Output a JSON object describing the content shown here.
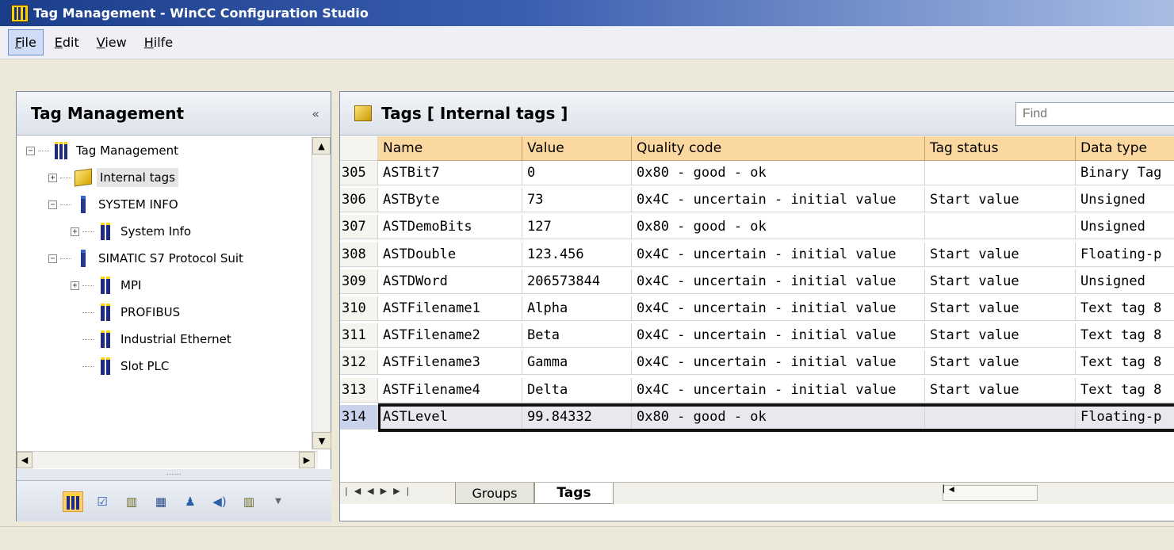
{
  "window": {
    "title": "Tag Management - WinCC Configuration Studio"
  },
  "menu": [
    {
      "label": "File",
      "ul": "F",
      "rest": "ile"
    },
    {
      "label": "Edit",
      "ul": "E",
      "rest": "dit"
    },
    {
      "label": "View",
      "ul": "V",
      "rest": "iew"
    },
    {
      "label": "Hilfe",
      "ul": "H",
      "rest": "ilfe"
    }
  ],
  "left_panel": {
    "title": "Tag Management",
    "collapse_glyph": "«",
    "tree": [
      {
        "label": "Tag Management",
        "expander": "−",
        "icon": "tag-management-icon",
        "indent": 0
      },
      {
        "label": "Internal tags",
        "expander": "+",
        "icon": "internal-tags-icon",
        "indent": 1,
        "selected": true
      },
      {
        "label": "SYSTEM INFO",
        "expander": "−",
        "icon": "connection-icon",
        "indent": 1
      },
      {
        "label": "System Info",
        "expander": "+",
        "icon": "tag-group-icon",
        "indent": 2
      },
      {
        "label": "SIMATIC S7 Protocol Suit",
        "expander": "−",
        "icon": "connection-icon",
        "indent": 1
      },
      {
        "label": "MPI",
        "expander": "+",
        "icon": "tag-group-icon",
        "indent": 2
      },
      {
        "label": "PROFIBUS",
        "expander": "",
        "icon": "tag-group-icon",
        "indent": 2
      },
      {
        "label": "Industrial Ethernet",
        "expander": "",
        "icon": "tag-group-icon",
        "indent": 2
      },
      {
        "label": "Slot PLC",
        "expander": "",
        "icon": "tag-group-icon",
        "indent": 2
      }
    ],
    "splitter_glyph": "......",
    "nav_icons": [
      "tag-management-icon",
      "alarm-icon",
      "archive-icon",
      "table-icon",
      "user-icon",
      "sound-icon",
      "structure-icon",
      "dropdown-arrow-icon"
    ]
  },
  "right_panel": {
    "title": "Tags [ Internal tags ]",
    "find_placeholder": "Find",
    "columns": [
      "Name",
      "Value",
      "Quality code",
      "Tag status",
      "Data type"
    ],
    "rows": [
      {
        "num": "305",
        "name": "ASTBit7",
        "value": "0",
        "quality": "0x80 - good - ok",
        "status": "",
        "dtype": "Binary Tag"
      },
      {
        "num": "306",
        "name": "ASTByte",
        "value": "73",
        "quality": "0x4C - uncertain - initial value",
        "status": "Start value",
        "dtype": "Unsigned"
      },
      {
        "num": "307",
        "name": "ASTDemoBits",
        "value": "127",
        "quality": "0x80 - good - ok",
        "status": "",
        "dtype": "Unsigned"
      },
      {
        "num": "308",
        "name": "ASTDouble",
        "value": "123.456",
        "quality": "0x4C - uncertain - initial value",
        "status": "Start value",
        "dtype": "Floating-p"
      },
      {
        "num": "309",
        "name": "ASTDWord",
        "value": "206573844",
        "quality": "0x4C - uncertain - initial value",
        "status": "Start value",
        "dtype": "Unsigned"
      },
      {
        "num": "310",
        "name": "ASTFilename1",
        "value": "Alpha",
        "quality": "0x4C - uncertain - initial value",
        "status": "Start value",
        "dtype": "Text tag 8"
      },
      {
        "num": "311",
        "name": "ASTFilename2",
        "value": "Beta",
        "quality": "0x4C - uncertain - initial value",
        "status": "Start value",
        "dtype": "Text tag 8"
      },
      {
        "num": "312",
        "name": "ASTFilename3",
        "value": "Gamma",
        "quality": "0x4C - uncertain - initial value",
        "status": "Start value",
        "dtype": "Text tag 8"
      },
      {
        "num": "313",
        "name": "ASTFilename4",
        "value": "Delta",
        "quality": "0x4C - uncertain - initial value",
        "status": "Start value",
        "dtype": "Text tag 8"
      },
      {
        "num": "314",
        "name": "ASTLevel",
        "value": "99.84332",
        "quality": "0x80 - good - ok",
        "status": "",
        "dtype": "Floating-p",
        "selected": true
      }
    ],
    "tabs": [
      "Groups",
      "Tags"
    ],
    "active_tab": "Tags"
  },
  "colors": {
    "header_cell": "#fbd8a0",
    "title_bar_start": "#1a3e8a",
    "active_nav": "#ffcf72"
  }
}
